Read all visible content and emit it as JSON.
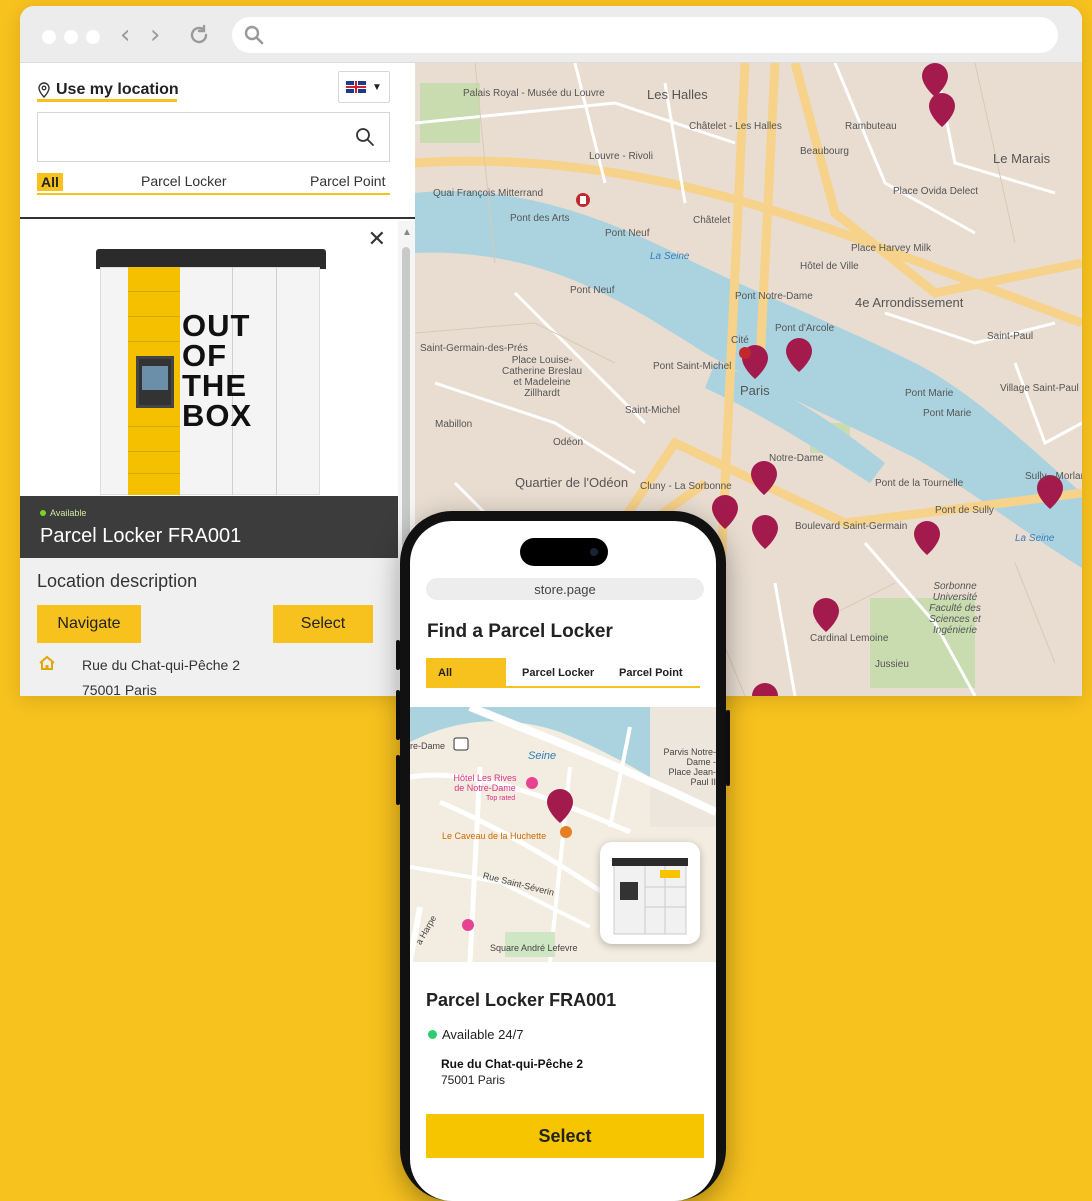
{
  "browser": {
    "address_value": ""
  },
  "panel": {
    "use_location": "Use my location",
    "search_value": "",
    "tabs": [
      "All",
      "Parcel Locker",
      "Parcel Point"
    ],
    "locker_graphic_text": [
      "OUT",
      "OF",
      "THE",
      "BOX"
    ],
    "card": {
      "status": "Available",
      "title": "Parcel Locker FRA001",
      "location_description": "Location description",
      "navigate_label": "Navigate",
      "select_label": "Select",
      "street": "Rue du Chat-qui-Pêche 2",
      "city": "75001 Paris"
    }
  },
  "map_labels": {
    "palais": "Palais Royal - Musée du Louvre",
    "les_halles": "Les Halles",
    "chatelet_les_halles": "Châtelet - Les Halles",
    "rambuteau": "Rambuteau",
    "beaubourg": "Beaubourg",
    "le_marais": "Le Marais",
    "louvre_rivoli": "Louvre - Rivoli",
    "quai_mitterrand": "Quai François Mitterrand",
    "pont_des_arts": "Pont des Arts",
    "pont_neuf_1": "Pont Neuf",
    "pont_neuf_2": "Pont Neuf",
    "chatelet": "Châtelet",
    "hotel_de_ville": "Hôtel de Ville",
    "place_ovida": "Place Ovida Delect",
    "place_harvey": "Place Harvey Milk",
    "arrondissement": "4e Arrondissement",
    "saint_germain": "Saint-Germain-des-Prés",
    "la_seine_1": "La Seine",
    "pont_notre_dame": "Pont Notre-Dame",
    "pont_arcole": "Pont d'Arcole",
    "cite": "Cité",
    "paris": "Paris",
    "place_louise": "Place Louise-Catherine Breslau et Madeleine Zillhardt",
    "pont_saint_michel": "Pont Saint-Michel",
    "saint_michel": "Saint-Michel",
    "mabillon": "Mabillon",
    "odeon": "Odéon",
    "notre_dame": "Notre-Dame",
    "pont_marie_1": "Pont Marie",
    "pont_marie_2": "Pont Marie",
    "saint_paul": "Saint-Paul",
    "village_saint_paul": "Village Saint-Paul",
    "quartier_odeon": "Quartier de l'Odéon",
    "cluny": "Cluny - La Sorbonne",
    "bd_saint_germain": "Boulevard Saint-Germain",
    "pont_tournelle": "Pont de la Tournelle",
    "pont_sully": "Pont de Sully",
    "sully_morland": "Sully - Morland",
    "sorbonne": "Sorbonne Université Faculté des Sciences et Ingénierie",
    "cardinal_lemoine": "Cardinal Lemoine",
    "jussieu": "Jussieu",
    "la_seine_2": "La Seine"
  },
  "phone": {
    "url": "store.page",
    "heading": "Find a Parcel Locker",
    "tabs": [
      "All",
      "Parcel Locker",
      "Parcel Point"
    ],
    "map": {
      "notre_dame_rer": "re-Dame",
      "seine": "Seine",
      "parvis": "Parvis Notre-Dame - Place Jean-Paul II",
      "hotel": "Hôtel Les Rives de Notre-Dame",
      "top_rated": "Top rated",
      "caveau": "Le Caveau de la Huchette",
      "rue_saint_severin": "Rue Saint-Séverin",
      "square_andre": "Square André Lefevre",
      "harpe": "a Harpe"
    },
    "title": "Parcel Locker FRA001",
    "availability": "Available 24/7",
    "street": "Rue du Chat-qui-Pêche 2",
    "city": "75001 Paris",
    "select_label": "Select"
  },
  "colors": {
    "background": "#f7c11e",
    "accent": "#f7c11e",
    "pin": "#a31b4c",
    "available": "#2ecc71"
  }
}
